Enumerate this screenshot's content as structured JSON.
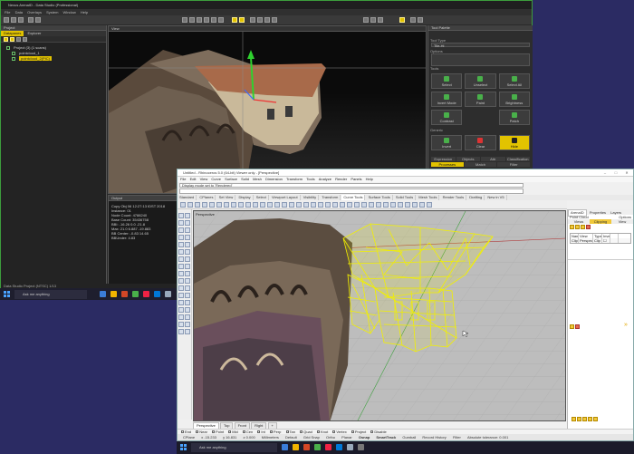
{
  "data_studio": {
    "title": "Nexus ArenaID - Data Studio (Professional)",
    "menu": [
      "File",
      "Data",
      "Overlays",
      "System",
      "Window",
      "Help"
    ],
    "project_panel": {
      "title": "Project",
      "tabs": [
        "Datapanes",
        "Explorer"
      ],
      "active_tab": "Datapanes",
      "tree": [
        {
          "label": "Project (3) (1 scans)",
          "selected": false
        },
        {
          "label": "pointcloud_1",
          "selected": false
        },
        {
          "label": "pointcloud_2(PIC)",
          "selected": true
        }
      ]
    },
    "viewport_title": "View",
    "output_panel": {
      "title": "Output",
      "log": [
        "Copy Obj 06 12:27:13 IDST 2018",
        "Instance: 01",
        "Node Count: 4788240",
        "Base Count: 35436758",
        "BBI: -16.26 0.0 -21.8",
        "Max: 21.0 6.887 -19.883",
        "BB Center: -0.83 14.65",
        "BBUnder: 4.83"
      ]
    },
    "tool_palette": {
      "title": "Tool Palette",
      "section_tool_type": "Tool Type",
      "field_tool_type": "Tile-Hi",
      "section_options": "Options",
      "section_tools": "Tools",
      "tools": [
        {
          "label": "Select",
          "highlight": false
        },
        {
          "label": "Unselect",
          "highlight": false
        },
        {
          "label": "Select All",
          "highlight": false
        },
        {
          "label": "Invert Mode",
          "highlight": false
        },
        {
          "label": "Paint",
          "highlight": false
        },
        {
          "label": "Brightness",
          "highlight": false
        },
        {
          "label": "Contrast",
          "highlight": false
        },
        {
          "label": "",
          "highlight": false
        },
        {
          "label": "Patch",
          "highlight": false
        }
      ],
      "section_generic": "Generic",
      "tools2": [
        {
          "label": "Invert",
          "highlight": false
        },
        {
          "label": "Clear",
          "highlight": false
        },
        {
          "label": "Hide",
          "highlight": true
        }
      ],
      "tabs": [
        "Expression",
        "Objects",
        "Attr",
        "Classification"
      ],
      "sub_tabs": [
        "Processes",
        "Match",
        "Filter"
      ],
      "active_sub_tab": "Processes",
      "tools3": [
        "Copy",
        "Delete",
        "Volume",
        "Profile",
        "Pixel Path"
      ]
    },
    "status": "Data Studio Project (NTSC) 1/13"
  },
  "taskbar1": {
    "search_placeholder": "Ask me anything"
  },
  "rhino": {
    "title": "Untitled - Rhinoceros 5.0 (64-bit) Viewer only - [Perspective]",
    "menu": [
      "File",
      "Edit",
      "View",
      "Curve",
      "Surface",
      "Solid",
      "Mesh",
      "Dimension",
      "Transform",
      "Tools",
      "Analyze",
      "Render",
      "Panels",
      "Help"
    ],
    "command_history": "Display mode set to 'Rendered'",
    "command_prompt": "",
    "toolbar_tabs": [
      "Standard",
      "CPlanes",
      "Set View",
      "Display",
      "Select",
      "Viewport Layout",
      "Visibility",
      "Transform",
      "Curve Tools",
      "Surface Tools",
      "Solid Tools",
      "Mesh Tools",
      "Render Tools",
      "Drafting",
      "New in V5"
    ],
    "active_toolbar_tab": "Curve Tools",
    "viewport_label": "Perspective",
    "viewport_tabs": [
      "Perspective",
      "Top",
      "Front",
      "Right"
    ],
    "active_viewport_tab": "Perspective",
    "osnaps": [
      "End",
      "Near",
      "Point",
      "Mid",
      "Cen",
      "Int",
      "Perp",
      "Tan",
      "Quad",
      "Knot",
      "Vertex",
      "Project",
      "Disable"
    ],
    "status_bar": [
      "CPlane",
      "x -15.233",
      "y 16.831",
      "z 0.000",
      "Millimeters",
      "Default",
      "Grid Snap",
      "Ortho",
      "Planar",
      "Osnap",
      "SmartTrack",
      "Gumball",
      "Record History",
      "Filter",
      "Absolute tolerance: 0.001"
    ],
    "right_panel": {
      "tabs": [
        "ArenaID",
        "Properties",
        "Layers"
      ],
      "active_tab": "ArenaID",
      "section": "Point Cloud",
      "options": "Options",
      "sub_tabs": [
        "Views",
        "Clipping",
        "View"
      ],
      "active_sub_tab": "Clipping",
      "table_headers": [
        "Name",
        "View",
        "Type",
        "Invert",
        ""
      ],
      "table_row": [
        "Clip",
        "Perspective",
        "Clip",
        "",
        ""
      ]
    }
  },
  "taskbar2": {
    "search_placeholder": "Ask me anything"
  },
  "colors": {
    "accent_yellow": "#e2c300",
    "accent_green": "#49b04a",
    "wireframe": "#f2f000",
    "rhino_bg": "#bdbdbd"
  }
}
